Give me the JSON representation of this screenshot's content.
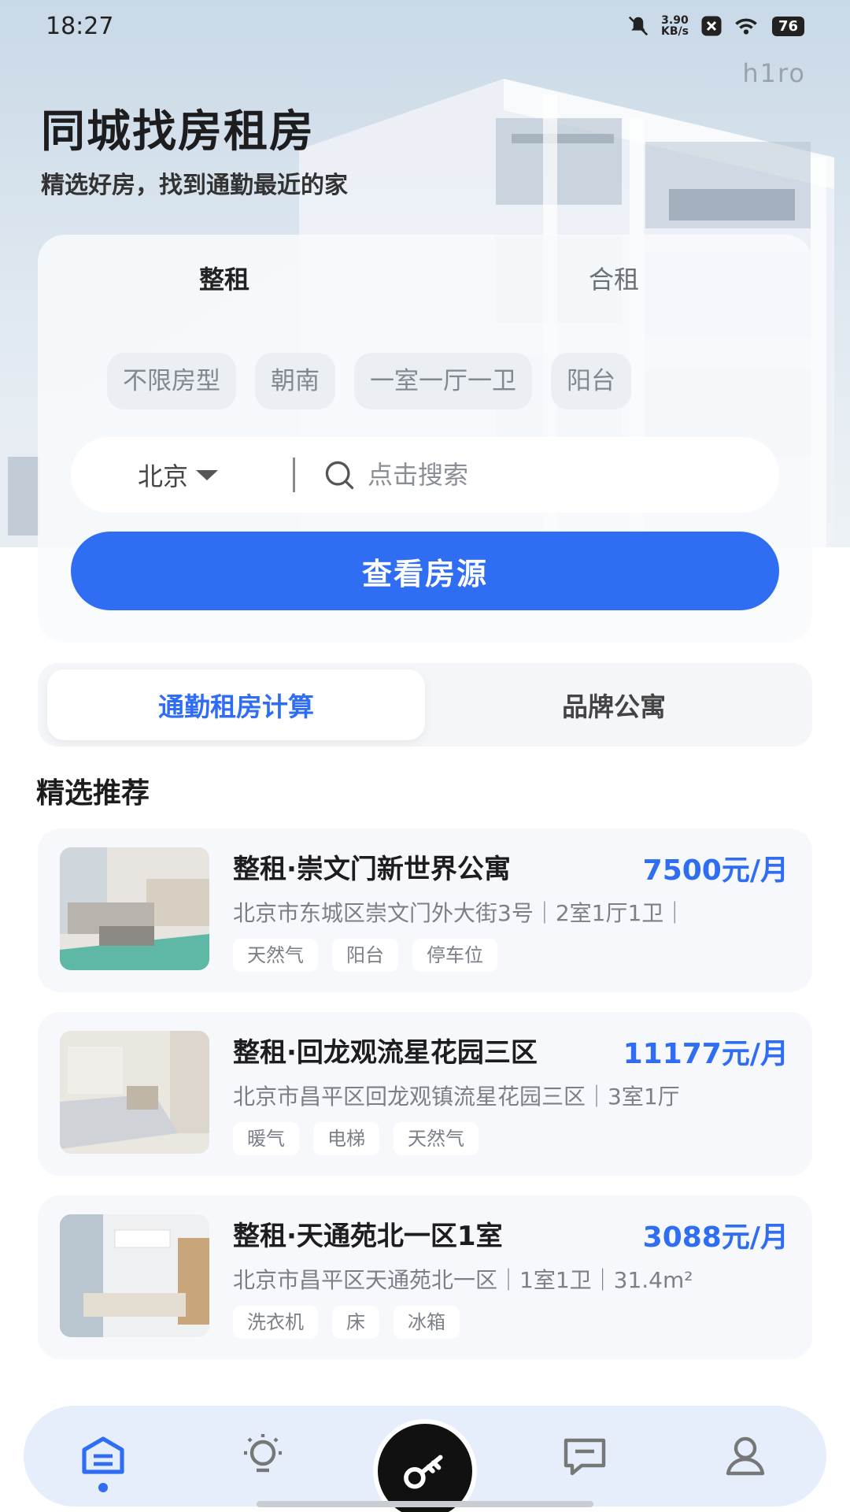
{
  "status_bar": {
    "time": "18:27",
    "net_speed_value": "3.90",
    "net_speed_unit": "KB/s",
    "battery": "76",
    "icons": [
      "bell-muted-icon",
      "notification-x-icon",
      "wifi-icon",
      "battery-icon"
    ]
  },
  "watermark": "h1ro",
  "header": {
    "title": "同城找房租房",
    "subtitle": "精选好房，找到通勤最近的家"
  },
  "search_card": {
    "segments": [
      {
        "label": "整租",
        "active": true
      },
      {
        "label": "合租",
        "active": false
      }
    ],
    "chips": [
      "不限房型",
      "朝南",
      "一室一厅一卫",
      "阳台"
    ],
    "city": "北京",
    "search_placeholder": "点击搜索",
    "button_label": "查看房源"
  },
  "tabs": [
    {
      "label": "通勤租房计算",
      "active": true
    },
    {
      "label": "品牌公寓",
      "active": false
    }
  ],
  "section_title": "精选推荐",
  "listings": [
    {
      "title": "整租·崇文门新世界公寓",
      "price": "7500元/月",
      "address": "北京市东城区崇文门外大街3号｜2室1厅1卫｜",
      "tags": [
        "天然气",
        "阳台",
        "停车位"
      ]
    },
    {
      "title": "整租·回龙观流星花园三区",
      "price": "11177元/月",
      "address": "北京市昌平区回龙观镇流星花园三区｜3室1厅",
      "tags": [
        "暖气",
        "电梯",
        "天然气"
      ]
    },
    {
      "title": "整租·天通苑北一区1室",
      "price": "3088元/月",
      "address": "北京市昌平区天通苑北一区｜1室1卫｜31.4m²",
      "tags": [
        "洗衣机",
        "床",
        "冰箱"
      ]
    }
  ],
  "nav": {
    "items": [
      "home-icon",
      "lightbulb-icon",
      "key-icon",
      "message-icon",
      "profile-icon"
    ],
    "active_index": 0
  },
  "colors": {
    "accent": "#2f6df3",
    "background": "#ffffff",
    "card": "#f6f8fb",
    "text": "#1d1d1f",
    "muted": "#7b8088"
  }
}
